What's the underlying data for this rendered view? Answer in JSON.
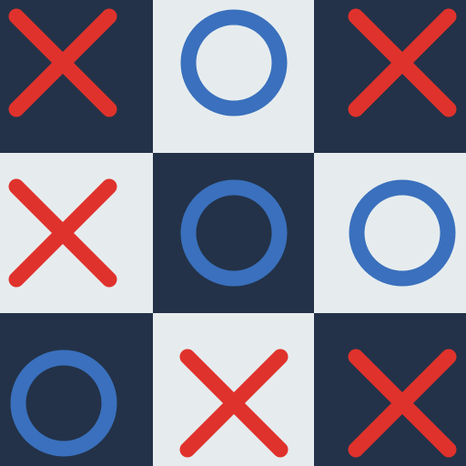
{
  "colors": {
    "dark_cell": "#233248",
    "light_cell": "#e6ecee",
    "x_mark": "#e0322c",
    "o_mark": "#3a70bd"
  },
  "board": [
    [
      "X",
      "O",
      "X"
    ],
    [
      "X",
      "O",
      "O"
    ],
    [
      "O",
      "X",
      "X"
    ]
  ],
  "cell_shades": [
    [
      "dark",
      "light",
      "dark"
    ],
    [
      "light",
      "dark",
      "light"
    ],
    [
      "dark",
      "light",
      "dark"
    ]
  ]
}
